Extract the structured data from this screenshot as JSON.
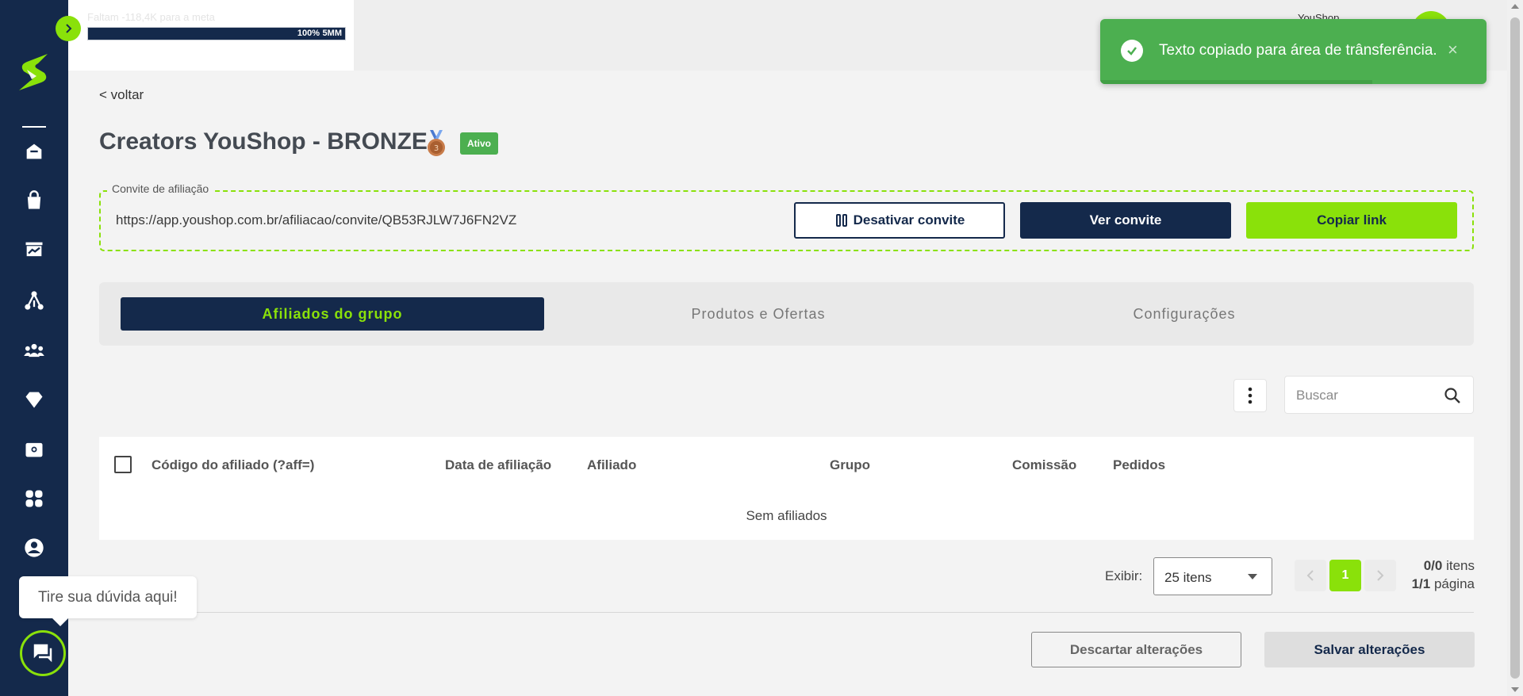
{
  "header": {
    "goal_text": "Faltam -118,4K para a meta",
    "goal_percent": "100%",
    "goal_target": "5MM",
    "goal_progress": 1.0,
    "user_name": "YouShop"
  },
  "toast": {
    "message": "Texto copiado para área de trânsferência.",
    "close_icon": "×"
  },
  "page": {
    "back_label": "< voltar",
    "title": "Creators YouShop - BRONZE",
    "status": "Ativo"
  },
  "invite": {
    "legend": "Convite de afiliação",
    "url": "https://app.youshop.com.br/afiliacao/convite/QB53RJLW7J6FN2VZ",
    "deactivate_label": "Desativar convite",
    "view_label": "Ver convite",
    "copy_label": "Copiar link"
  },
  "tabs": [
    {
      "label": "Afiliados do grupo",
      "active": true
    },
    {
      "label": "Produtos e Ofertas",
      "active": false
    },
    {
      "label": "Configurações",
      "active": false
    }
  ],
  "search": {
    "placeholder": "Buscar"
  },
  "table": {
    "columns": [
      "Código do afiliado (?aff=)",
      "Data de afiliação",
      "Afiliado",
      "Grupo",
      "Comissão",
      "Pedidos"
    ],
    "empty_message": "Sem afiliados"
  },
  "pagination": {
    "show_label": "Exibir:",
    "page_size": "25 itens",
    "current_page": "1",
    "items_count": "0/0",
    "items_label": "itens",
    "pages_count": "1/1",
    "pages_label": "página"
  },
  "footer": {
    "discard_label": "Descartar alterações",
    "save_label": "Salvar alterações"
  },
  "help": {
    "bubble_text": "Tire sua dúvida aqui!"
  },
  "sidebar": {
    "icons": [
      "home-icon",
      "shopping-bag-icon",
      "dashboard-icon",
      "affiliates-network-icon",
      "users-group-icon",
      "diamond-icon",
      "wallet-icon",
      "apps-icon",
      "account-icon"
    ]
  },
  "colors": {
    "navy": "#14294b",
    "lime": "#8ae10a",
    "success": "#4caf50"
  }
}
